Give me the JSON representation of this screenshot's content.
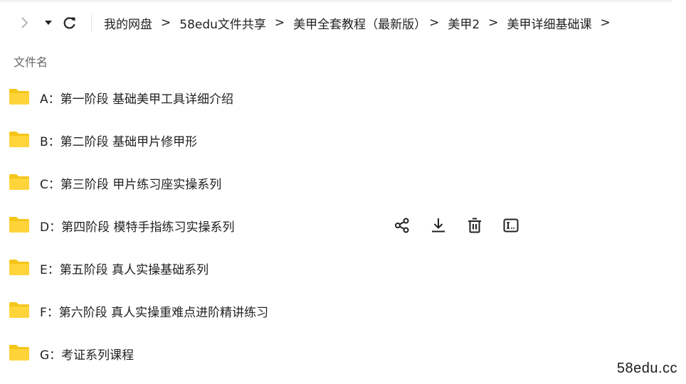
{
  "breadcrumb": [
    "我的网盘",
    "58edu文件共享",
    "美甲全套教程（最新版）",
    "美甲2",
    "美甲详细基础课"
  ],
  "breadcrumb_separator": ">",
  "list_header": {
    "name_label": "文件名"
  },
  "files": [
    {
      "name": "A：第一阶段 基础美甲工具详细介绍",
      "type": "folder"
    },
    {
      "name": "B：第二阶段 基础甲片修甲形",
      "type": "folder"
    },
    {
      "name": "C：第三阶段 甲片练习座实操系列",
      "type": "folder"
    },
    {
      "name": "D：第四阶段 模特手指练习实操系列",
      "type": "folder",
      "hovered": true
    },
    {
      "name": "E：第五阶段 真人实操基础系列",
      "type": "folder"
    },
    {
      "name": "F：第六阶段 真人实操重难点进阶精讲练习",
      "type": "folder"
    },
    {
      "name": "G：考证系列课程",
      "type": "folder"
    }
  ],
  "row_actions": [
    "share-icon",
    "download-icon",
    "delete-icon",
    "rename-icon"
  ],
  "watermark": "58edu.cc",
  "colors": {
    "folder": "#ffd43b",
    "folder_dark": "#f5c518",
    "text": "#222222",
    "header_text": "#666666"
  }
}
